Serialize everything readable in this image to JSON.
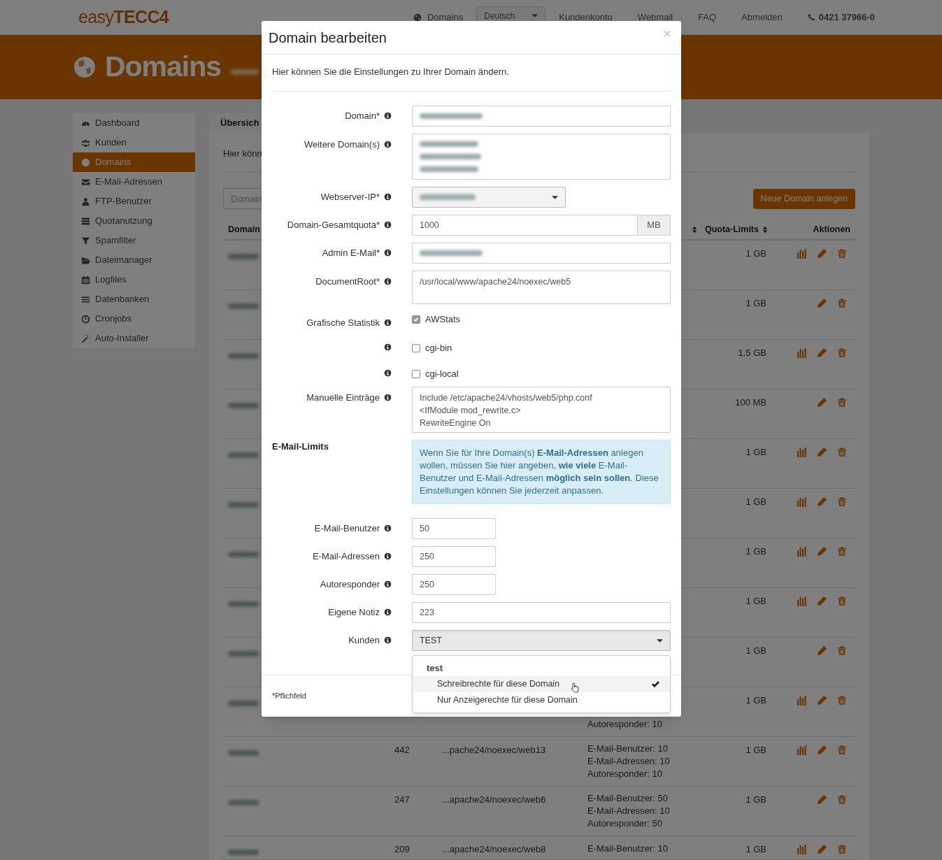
{
  "topbar": {
    "logo": "easy**TECC4**",
    "nav": [
      {
        "kind": "icon_link",
        "label": "Domains"
      },
      {
        "kind": "dropdown",
        "label": "Deutsch"
      },
      {
        "kind": "link",
        "label": "Kundenkonto"
      },
      {
        "kind": "link",
        "label": "Webmail"
      },
      {
        "kind": "link",
        "label": "FAQ"
      },
      {
        "kind": "link",
        "label": "Abmelden"
      },
      {
        "kind": "phone",
        "label": "0421 37966-0"
      }
    ]
  },
  "banner": {
    "title": "Domains"
  },
  "sidebar": {
    "items": [
      {
        "label": "Dashboard",
        "selected": false
      },
      {
        "label": "Kunden",
        "selected": false
      },
      {
        "label": "Domains",
        "selected": true
      },
      {
        "label": "E-Mail-Adressen",
        "selected": false
      },
      {
        "label": "FTP-Benutzer",
        "selected": false
      },
      {
        "label": "Quotanutzung",
        "selected": false
      },
      {
        "label": "Spamfilter",
        "selected": false
      },
      {
        "label": "Dateimanager",
        "selected": false
      },
      {
        "label": "Logfiles",
        "selected": false
      },
      {
        "label": "Datenbanken",
        "selected": false
      },
      {
        "label": "Cronjobs",
        "selected": false
      },
      {
        "label": "Auto-Installer",
        "selected": false
      }
    ]
  },
  "main": {
    "heading": "Übersich",
    "intro": "Hier könn",
    "search": {
      "placeholder": "Domain"
    },
    "new_button": "Neue Domain anlegen",
    "table": {
      "columns": [
        {
          "label": "Domain",
          "sortable": false
        },
        {
          "sortable": true
        },
        {
          "label": "Quota-Limits",
          "sortable": true
        },
        {
          "label": "Aktionen",
          "sortable": false
        }
      ],
      "rows": [
        {
          "quota": "1 GB",
          "stats": true
        },
        {
          "quota": "1 GB",
          "stats": false
        },
        {
          "quota": "1.5 GB",
          "stats": true
        },
        {
          "quota": "100 MB",
          "stats": false
        },
        {
          "quota": "1 GB",
          "stats": true
        },
        {
          "quota": "1 GB",
          "stats": true
        },
        {
          "quota": "1 GB",
          "stats": true
        },
        {
          "quota": "1 GB",
          "stats": true
        },
        {
          "quota": "1 GB",
          "stats": false
        },
        {
          "limits": [
            "Autoresponder: 10"
          ],
          "quota": "1 GB",
          "stats": true
        },
        {
          "number": "442",
          "path": "...pache24/noexec/web13",
          "limits": [
            "E-Mail-Benutzer: 10",
            "E-Mail-Adressen: 10",
            "Autoresponder: 10"
          ],
          "quota": "1 GB",
          "stats": true
        },
        {
          "number": "247",
          "path": "...apache24/noexec/web6",
          "limits": [
            "E-Mail-Benutzer: 50",
            "E-Mail-Adressen: 10",
            "Autoresponder: 50"
          ],
          "quota": "1 GB",
          "stats": false
        },
        {
          "number": "209",
          "path": "...apache24/noexec/web8",
          "limits": [
            "E-Mail-Benutzer: 10"
          ],
          "quota": "1 GB",
          "stats": true
        }
      ]
    }
  },
  "modal": {
    "title": "Domain bearbeiten",
    "close": "×",
    "intro": "Hier können Sie die Einstellungen zu Ihrer Domain ändern.",
    "fields": [
      {
        "kind": "input",
        "label": "Domain*",
        "blurred": true
      },
      {
        "kind": "textarea",
        "label": "Weitere Domain(s)",
        "blurred": true
      },
      {
        "kind": "select_short",
        "label": "Webserver-IP*",
        "blurred": true
      },
      {
        "kind": "input_addon",
        "label": "Domain-Gesamtquota*",
        "value": "1000",
        "addon": "MB"
      },
      {
        "kind": "input",
        "label": "Admin E-Mail*",
        "blurred": true
      },
      {
        "kind": "textarea",
        "label": "DocumentRoot*",
        "lines": [
          "/usr/local/www/apache24/noexec/web5"
        ]
      },
      {
        "kind": "checkbox",
        "label": "Grafische Statistik",
        "option": "AWStats",
        "checked": true
      },
      {
        "kind": "checkbox",
        "option": "cgi-bin",
        "checked": false
      },
      {
        "kind": "checkbox",
        "option": "cgi-local",
        "checked": false
      },
      {
        "kind": "textarea",
        "label": "Manuelle Einträge",
        "lines": [
          "Include /etc/apache24/vhosts/web5/php.conf",
          "<IfModule mod_rewrite.c>",
          "RewriteEngine On"
        ]
      },
      {
        "kind": "note",
        "label": "E-Mail-Limits",
        "text": "Wenn Sie für Ihre Domain(s) **E-Mail-Adressen** anlegen wollen, müssen Sie hier angeben, **wie viele** E-Mail-Benutzer und E-Mail-Adressen **möglich sein sollen**. Diese Einstellungen können Sie jederzeit anpassen."
      },
      {
        "kind": "input_short",
        "label": "E-Mail-Benutzer",
        "value": "50"
      },
      {
        "kind": "input_short",
        "label": "E-Mail-Adressen",
        "value": "250"
      },
      {
        "kind": "input_short",
        "label": "Autoresponder",
        "value": "250"
      },
      {
        "kind": "input",
        "label": "Eigene Notiz",
        "value": "223"
      },
      {
        "kind": "select",
        "label": "Kunden",
        "value": "TEST",
        "open": true,
        "menu": {
          "group": "test",
          "options": [
            {
              "label": "Schreibrechte für diese Domain",
              "selected": true
            },
            {
              "label": "Nur Anzeigerechte für diese Domain",
              "selected": false
            }
          ]
        }
      }
    ],
    "footer_note": "*Pflichfeld"
  }
}
